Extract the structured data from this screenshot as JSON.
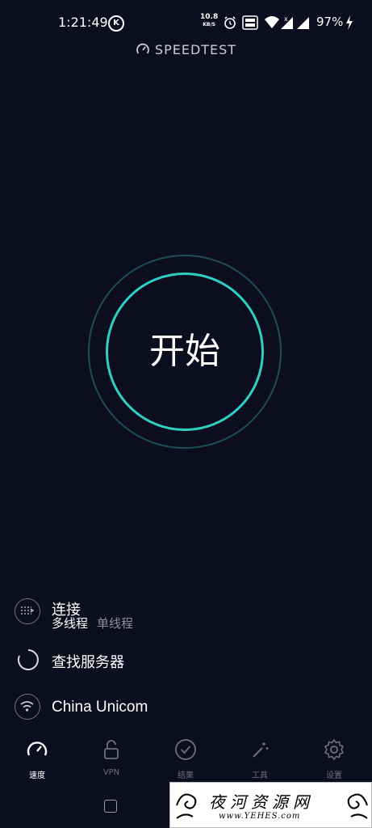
{
  "status_bar": {
    "time": "1:21:49",
    "k_badge": "K",
    "net_speed": "10.8",
    "net_unit": "KB/S",
    "battery": "97%"
  },
  "header": {
    "title": "SPEEDTEST"
  },
  "start": {
    "label": "开始"
  },
  "connection": {
    "title": "连接",
    "selected_mode": "多线程",
    "other_mode": "单线程"
  },
  "server": {
    "status": "查找服务器"
  },
  "isp": {
    "name": "China Unicom"
  },
  "nav": {
    "items": [
      {
        "label": "速度",
        "icon": "speedometer-icon",
        "active": true
      },
      {
        "label": "VPN",
        "icon": "lock-icon",
        "active": false
      },
      {
        "label": "结果",
        "icon": "check-circle-icon",
        "active": false
      },
      {
        "label": "工具",
        "icon": "magic-wand-icon",
        "active": false
      },
      {
        "label": "设置",
        "icon": "gear-icon",
        "active": false
      }
    ]
  },
  "watermark": {
    "title": "夜河资源网",
    "url": "www.YEHES.com"
  },
  "colors": {
    "background": "#0c0e1f",
    "accent": "#2fd0c4"
  }
}
